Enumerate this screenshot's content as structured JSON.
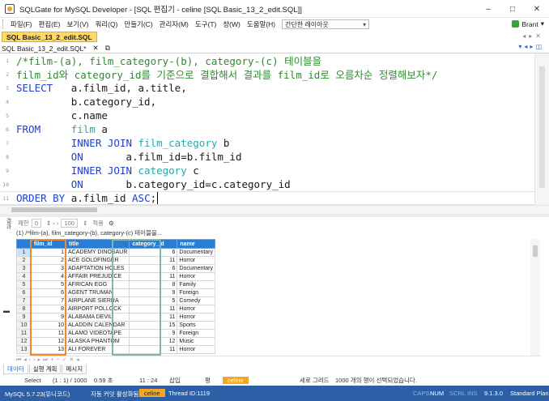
{
  "window": {
    "title": "SQLGate for MySQL Developer - [SQL 편집기 - celine [SQL Basic_13_2_edit.SQL]]",
    "controls": [
      "–",
      "□",
      "✕"
    ]
  },
  "menu": {
    "items": [
      "파일(F)",
      "편집(E)",
      "보기(V)",
      "쿼리(Q)",
      "만들기(C)",
      "관리자(M)",
      "도구(T)",
      "창(W)",
      "도움말(H)"
    ],
    "layout_select": "간단한 레이아웃",
    "user": "Brant"
  },
  "doc_tab": {
    "label": "SQL Basic_13_2_edit.SQL"
  },
  "file_tab": {
    "label": "SQL Basic_13_2_edit.SQL*",
    "close": "✕"
  },
  "editor": {
    "lines": [
      {
        "n": "1",
        "parts": [
          {
            "t": "/*film-(a), film_category-(b), category-(c) 테이블을",
            "c": "cm"
          }
        ]
      },
      {
        "n": "2",
        "parts": [
          {
            "t": "film_id",
            "c": "cm"
          },
          {
            "t": "와 ",
            "c": "cm"
          },
          {
            "t": "category_id",
            "c": "cm"
          },
          {
            "t": "를 기준으로 결합해서 결과를 ",
            "c": "cm"
          },
          {
            "t": "film_id",
            "c": "cm"
          },
          {
            "t": "로 오름차순 정렬해보자*/",
            "c": "cm"
          }
        ]
      },
      {
        "n": "3",
        "parts": [
          {
            "t": "SELECT",
            "c": "kw"
          },
          {
            "t": "   a.film_id, a.title,",
            "c": ""
          }
        ]
      },
      {
        "n": "4",
        "parts": [
          {
            "t": "         b.category_id,",
            "c": ""
          }
        ]
      },
      {
        "n": "5",
        "parts": [
          {
            "t": "         c.name",
            "c": ""
          }
        ]
      },
      {
        "n": "6",
        "parts": [
          {
            "t": "FROM",
            "c": "kw"
          },
          {
            "t": "     ",
            "c": ""
          },
          {
            "t": "film",
            "c": "tb"
          },
          {
            "t": " a",
            "c": ""
          }
        ]
      },
      {
        "n": "7",
        "parts": [
          {
            "t": "         ",
            "c": ""
          },
          {
            "t": "INNER JOIN",
            "c": "kw"
          },
          {
            "t": " ",
            "c": ""
          },
          {
            "t": "film_category",
            "c": "tb"
          },
          {
            "t": " b",
            "c": ""
          }
        ]
      },
      {
        "n": "8",
        "parts": [
          {
            "t": "         ",
            "c": ""
          },
          {
            "t": "ON",
            "c": "kw"
          },
          {
            "t": "       a.film_id=b.film_id",
            "c": ""
          }
        ]
      },
      {
        "n": "9",
        "parts": [
          {
            "t": "         ",
            "c": ""
          },
          {
            "t": "INNER JOIN",
            "c": "kw"
          },
          {
            "t": " ",
            "c": ""
          },
          {
            "t": "category",
            "c": "tb"
          },
          {
            "t": " c",
            "c": ""
          }
        ]
      },
      {
        "n": "10",
        "parts": [
          {
            "t": "         ",
            "c": ""
          },
          {
            "t": "ON",
            "c": "kw"
          },
          {
            "t": "       b.category_id=c.category_id",
            "c": ""
          }
        ]
      },
      {
        "n": "11",
        "parts": [
          {
            "t": "ORDER BY",
            "c": "kw"
          },
          {
            "t": " a.film_id ",
            "c": ""
          },
          {
            "t": "ASC",
            "c": "kw"
          },
          {
            "t": ";",
            "c": ""
          }
        ]
      }
    ]
  },
  "result_toolbar": {
    "limit_label": "제한",
    "limit_value": "0",
    "page_value": "100",
    "apply_label": "적용"
  },
  "result": {
    "query_label": "(1) /*film-(a), film_category-(b), category-(c) 테이블을...",
    "columns": [
      "film_id",
      "title",
      "category_id",
      "name"
    ],
    "rows": [
      [
        "1",
        "1",
        "ACADEMY DINOSAUR",
        "6",
        "Documentary"
      ],
      [
        "2",
        "2",
        "ACE GOLDFINGER",
        "11",
        "Horror"
      ],
      [
        "3",
        "3",
        "ADAPTATION HOLES",
        "6",
        "Documentary"
      ],
      [
        "4",
        "4",
        "AFFAIR PREJUDICE",
        "11",
        "Horror"
      ],
      [
        "5",
        "5",
        "AFRICAN EGG",
        "8",
        "Family"
      ],
      [
        "6",
        "6",
        "AGENT TRUMAN",
        "9",
        "Foreign"
      ],
      [
        "7",
        "7",
        "AIRPLANE SIERRA",
        "5",
        "Comedy"
      ],
      [
        "8",
        "8",
        "AIRPORT POLLOCK",
        "11",
        "Horror"
      ],
      [
        "9",
        "9",
        "ALABAMA DEVIL",
        "11",
        "Horror"
      ],
      [
        "10",
        "10",
        "ALADDIN CALENDAR",
        "15",
        "Sports"
      ],
      [
        "11",
        "11",
        "ALAMO VIDEOTAPE",
        "9",
        "Foreign"
      ],
      [
        "12",
        "12",
        "ALASKA PHANTOM",
        "12",
        "Music"
      ],
      [
        "13",
        "13",
        "ALI FOREVER",
        "11",
        "Horror"
      ]
    ]
  },
  "bottom_tabs": [
    "데이터",
    "실행 계획",
    "메시지"
  ],
  "status_line": {
    "command": "Select",
    "rows": "(1 : 1) / 1000",
    "time": "0.59 초",
    "cursor": "11 : 24",
    "mode": "삽입",
    "extra": "평",
    "connection": "celine",
    "grid_label": "세로 그리드",
    "message": "1000 개의 행이 선택되었습니다."
  },
  "status_bar": {
    "server": "MySQL 5.7.23(유니코드)",
    "autocommit": "자동 커밋 활성화됨",
    "db": "celine",
    "thread": "Thread ID:1119",
    "caps": "CAPS",
    "num": "NUM",
    "scrl": "SCRL",
    "ins": "INS",
    "version": "9.1.3.0",
    "plan": "Standard Plan"
  }
}
